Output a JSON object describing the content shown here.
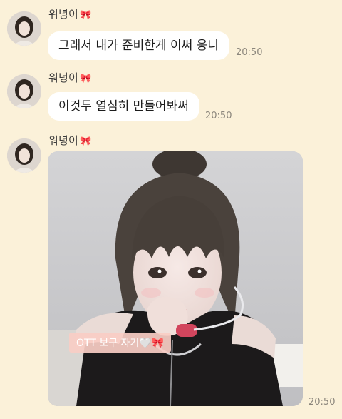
{
  "messages": [
    {
      "sender": "워녕이",
      "sender_emoji": "🎀",
      "text": "그래서 내가 준비한게 이써 웅니",
      "time": "20:50"
    },
    {
      "sender": "워녕이",
      "sender_emoji": "🎀",
      "text": "이것두 열심히 만들어봐써",
      "time": "20:50"
    },
    {
      "sender": "워녕이",
      "sender_emoji": "🎀",
      "photo_caption": "OTT 보구 자기🤍🎀",
      "time": "20:50"
    }
  ],
  "colors": {
    "background": "#fbf1d9",
    "bubble": "#ffffff",
    "caption_sticker": "#f8cdc4"
  }
}
